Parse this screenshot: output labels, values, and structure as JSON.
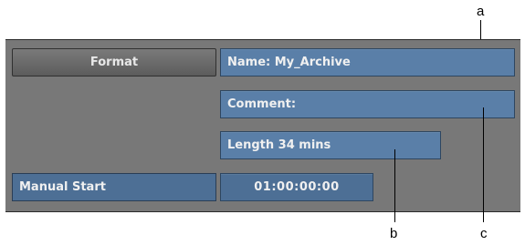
{
  "panel": {
    "format_button": "Format",
    "manual_start_button": "Manual Start",
    "name_field": "Name: My_Archive",
    "comment_field": "Comment:",
    "length_field": "Length 34 mins",
    "start_time_field": "01:00:00:00"
  },
  "callouts": {
    "a": "a",
    "b": "b",
    "c": "c"
  },
  "colors": {
    "panel_background": "#787878",
    "field_blue": "#5a7fa8",
    "button_blue": "#4d6f95",
    "button_gray": "#6a6a6a"
  }
}
